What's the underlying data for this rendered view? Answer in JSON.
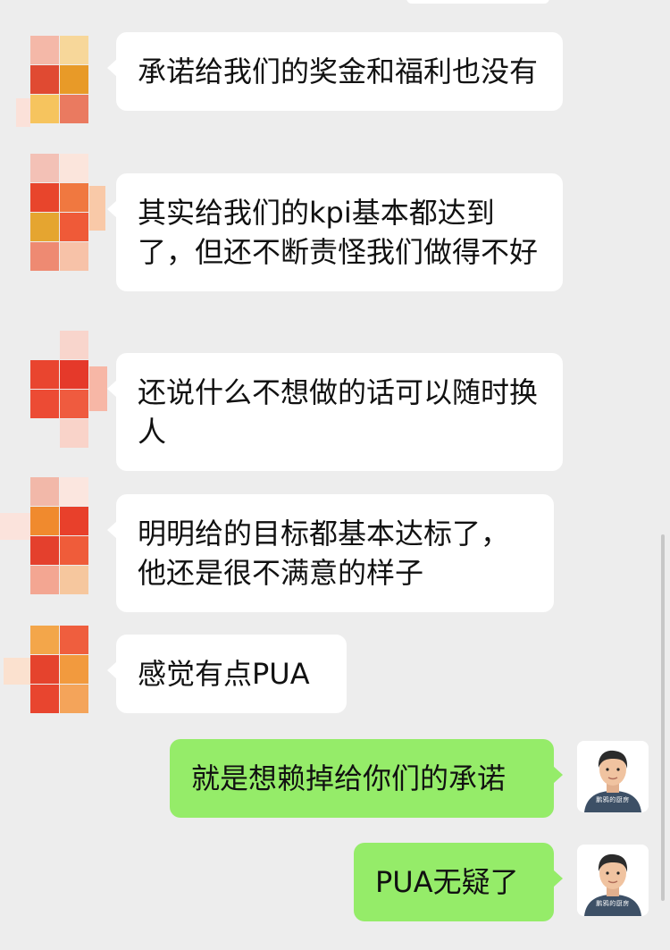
{
  "messages": [
    {
      "side": "received",
      "text": "承诺给我们的奖金和福利也没有"
    },
    {
      "side": "received",
      "text": "其实给我们的kpi基本都达到了，但还不断责怪我们做得不好"
    },
    {
      "side": "received",
      "text": "还说什么不想做的话可以随时换人"
    },
    {
      "side": "received",
      "text": "明明给的目标都基本达标了，他还是很不满意的样子"
    },
    {
      "side": "received",
      "text": "感觉有点PUA"
    },
    {
      "side": "sent",
      "text": "就是想赖掉给你们的承诺"
    },
    {
      "side": "sent",
      "text": "PUA无疑了"
    }
  ],
  "self_avatar": {
    "shirt_text": "鹏鸦的厨房"
  },
  "colors": {
    "background": "#ededed",
    "received_bubble": "#ffffff",
    "sent_bubble": "#95ec69",
    "text": "#111111"
  }
}
